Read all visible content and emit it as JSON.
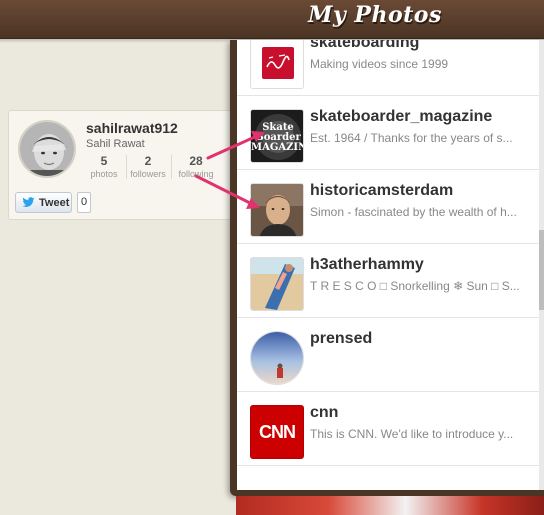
{
  "app": {
    "title": "My Photos"
  },
  "profile": {
    "username": "sahilrawat912",
    "fullname": "Sahil Rawat",
    "stats": [
      {
        "value": "5",
        "label": "photos"
      },
      {
        "value": "2",
        "label": "followers"
      },
      {
        "value": "28",
        "label": "following"
      }
    ],
    "tweet_label": "Tweet",
    "tweet_count": "0"
  },
  "following_list": [
    {
      "name": "skateboarding",
      "bio": "Making videos since 1999"
    },
    {
      "name": "skateboarder_magazine",
      "bio": "Est. 1964 / Thanks for the years of s..."
    },
    {
      "name": "historicamsterdam",
      "bio": "Simon - fascinated by the wealth of h..."
    },
    {
      "name": "h3atherhammy",
      "bio": "T R E S C O □ Snorkelling ❄ Sun □ S..."
    },
    {
      "name": "prensed",
      "bio": ""
    },
    {
      "name": "cnn",
      "bio": "This is CNN. We'd like to introduce y..."
    }
  ],
  "thumb_labels": {
    "skateboarder_magazine": "Skate Boarder MAGAZINE",
    "cnn": "CNN"
  },
  "colors": {
    "header_brown": "#5a3e2b",
    "arrow_pink": "#e0326e",
    "cnn_red": "#cc0000"
  }
}
